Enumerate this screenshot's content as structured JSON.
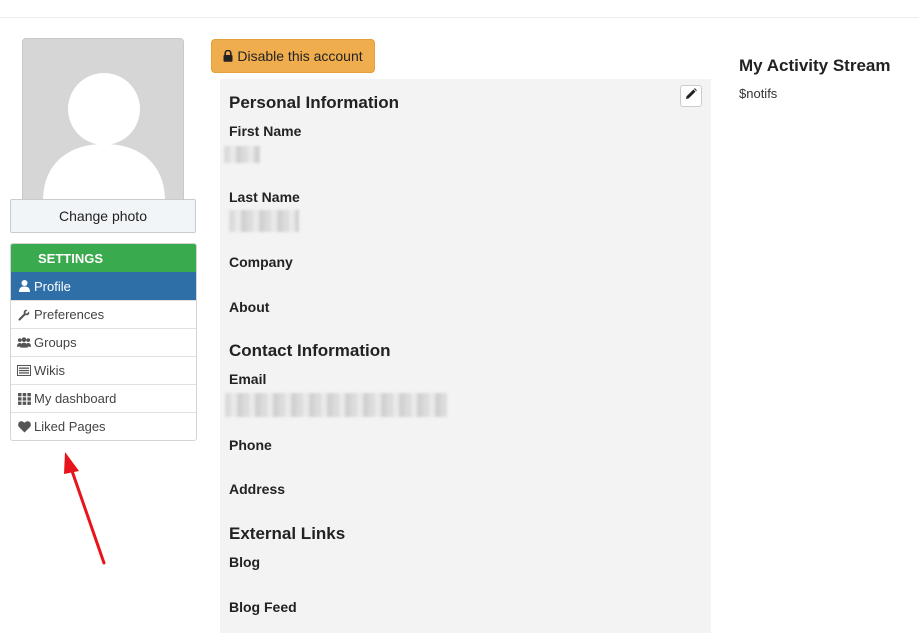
{
  "avatar": {
    "change_photo_label": "Change photo"
  },
  "settings": {
    "header": "SETTINGS",
    "items": [
      {
        "label": "Profile",
        "icon": "user-icon",
        "active": true
      },
      {
        "label": "Preferences",
        "icon": "wrench-icon"
      },
      {
        "label": "Groups",
        "icon": "users-icon"
      },
      {
        "label": "Wikis",
        "icon": "list-icon"
      },
      {
        "label": "My dashboard",
        "icon": "grid-icon"
      },
      {
        "label": "Liked Pages",
        "icon": "heart-icon"
      }
    ]
  },
  "account": {
    "disable_label": "Disable this account",
    "icon": "lock-icon"
  },
  "profile": {
    "edit_icon": "pencil-icon",
    "personal": {
      "title": "Personal Information",
      "first_name_label": "First Name",
      "last_name_label": "Last Name",
      "company_label": "Company",
      "about_label": "About"
    },
    "contact": {
      "title": "Contact Information",
      "email_label": "Email",
      "phone_label": "Phone",
      "address_label": "Address"
    },
    "external": {
      "title": "External Links",
      "blog_label": "Blog",
      "blog_feed_label": "Blog Feed"
    }
  },
  "activity": {
    "title": "My Activity Stream",
    "placeholder": "$notifs"
  },
  "colors": {
    "settings_header": "#3aaa4e",
    "active_item": "#2f6fa8",
    "warning_button": "#f0ad4e",
    "annotation_arrow": "#e8141c"
  }
}
